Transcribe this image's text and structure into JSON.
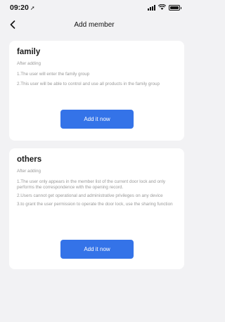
{
  "status_bar": {
    "time": "09:20",
    "icons": [
      "location-arrow-icon",
      "signal-icon",
      "wifi-icon",
      "battery-icon"
    ]
  },
  "nav": {
    "title": "Add member",
    "back_icon": "chevron-left-icon"
  },
  "cards": [
    {
      "title": "family",
      "subtitle": "After adding",
      "rules": [
        "1.The user will enter the family group",
        "2.This user will be able to control and use all products in the family group"
      ],
      "button_label": "Add it now"
    },
    {
      "title": "others",
      "subtitle": "After adding",
      "rules": [
        "1.The user only appears in the member list of the current door lock and only performs the correspondence with the opening record.",
        "2.Users cannot get operational and administrative privileges on any device",
        "3.to grant the user permission to operate the door lock, use the sharing function"
      ],
      "button_label": "Add it now"
    }
  ],
  "colors": {
    "background": "#f2f2f4",
    "card": "#ffffff",
    "accent": "#3473e8",
    "muted_text": "#9a9a9a"
  }
}
